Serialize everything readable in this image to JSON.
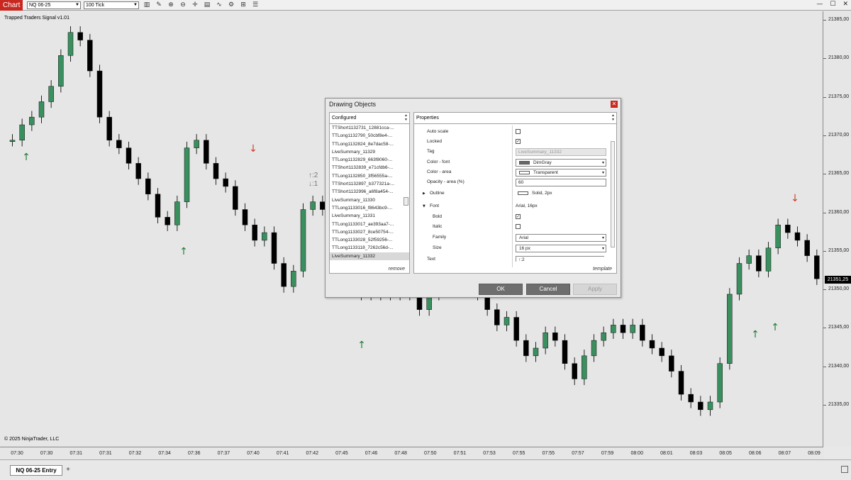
{
  "toolbar": {
    "chart_tab": "Chart",
    "instrument": "NQ 06-25",
    "interval": "100 Tick"
  },
  "chart": {
    "indicator_title": "Trapped Traders Signal v1.01",
    "copyright": "© 2025 NinjaTrader, LLC",
    "price_labels": [
      "21385,00",
      "21380,00",
      "21375,00",
      "21370,00",
      "21365,00",
      "21360,00",
      "21355,00",
      "21350,00",
      "21345,00",
      "21340,00",
      "21335,00"
    ],
    "current_price": "21351,25",
    "time_labels": [
      "07:30",
      "07:30",
      "07:31",
      "07:31",
      "07:32",
      "07:34",
      "07:36",
      "07:37",
      "07:40",
      "07:41",
      "07:42",
      "07:45",
      "07:46",
      "07:48",
      "07:50",
      "07:51",
      "07:53",
      "07:55",
      "07:55",
      "07:57",
      "07:59",
      "08:00",
      "08:01",
      "08:03",
      "08:05",
      "08:06",
      "08:07",
      "08:09"
    ],
    "annotation": "↑:2\n↓:1",
    "colors": {
      "up": "#3a8f5f",
      "down": "#000000",
      "signal_up": "#1e7b34",
      "signal_down": "#d0392b"
    }
  },
  "dialog": {
    "title": "Drawing Objects",
    "configured_header": "Configured",
    "properties_header": "Properties",
    "configured_items": [
      "TTShort1132731_12881cca-...",
      "TTLong1132790_50cbf8e4-...",
      "TTLong1132824_8e7dac58-...",
      "LiveSummary_11329",
      "TTLong1132829_663f8060-...",
      "TTShort1132839_e71cfdb6-...",
      "TTLong1132850_3f56555a-...",
      "TTShort1132897_b377321a-...",
      "TTShort1132996_a6f8a454-...",
      "LiveSummary_11330",
      "TTLong1133016_f8643bc9-...",
      "LiveSummary_11331",
      "TTLong1133017_ae393aa7-...",
      "TTLong1133027_8ce50754-...",
      "TTLong1133028_52f59256-...",
      "TTLong1133118_7262c56d-...",
      "LiveSummary_11332"
    ],
    "selected_item": "LiveSummary_11332",
    "remove_label": "remove",
    "template_label": "template",
    "properties": {
      "auto_scale": "Auto scale",
      "locked": "Locked",
      "tag": "Tag",
      "tag_value": "LiveSummary_11332",
      "color_font": "Color - font",
      "color_font_value": "DimGray",
      "color_area": "Color - area",
      "color_area_value": "Transparent",
      "opacity": "Opacity - area (%)",
      "opacity_value": "60",
      "outline": "Outline",
      "outline_value": "Solid, 2px",
      "font": "Font",
      "font_value": "Arial, 16px",
      "bold": "Bold",
      "italic": "Italic",
      "family": "Family",
      "family_value": "Arial",
      "size": "Size",
      "size_value": "16 px",
      "text": "Text",
      "text_value": "↑:2"
    },
    "buttons": {
      "ok": "OK",
      "cancel": "Cancel",
      "apply": "Apply"
    }
  },
  "bottom": {
    "tab_label": "NQ 06-25 Entry",
    "add_tab": "+"
  }
}
